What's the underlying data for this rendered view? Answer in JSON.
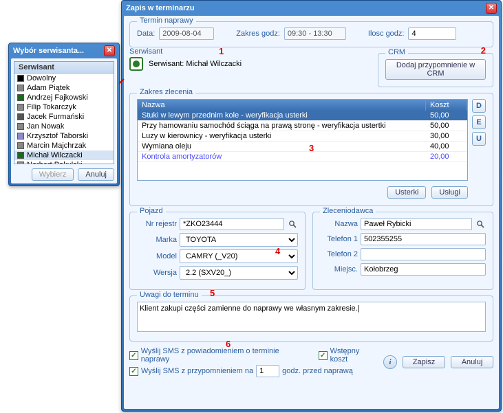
{
  "popup": {
    "title": "Wybór serwisanta...",
    "header": "Serwisant",
    "items": [
      {
        "name": "Dowolny",
        "color": "#000"
      },
      {
        "name": "Adam Piątek",
        "color": "#888"
      },
      {
        "name": "Andrzej Fajkowski",
        "color": "#1a6a1a"
      },
      {
        "name": "Filip Tokarczyk",
        "color": "#888"
      },
      {
        "name": "Jacek Furmański",
        "color": "#555"
      },
      {
        "name": "Jan Nowak",
        "color": "#888"
      },
      {
        "name": "Krzysztof Taborski",
        "color": "#8a8ad0"
      },
      {
        "name": "Marcin Majchrzak",
        "color": "#888"
      },
      {
        "name": "Michał Wilczacki",
        "color": "#1a6a1a"
      },
      {
        "name": "Norbert Pakulski",
        "color": "#888"
      }
    ],
    "btn_select": "Wybierz",
    "btn_cancel": "Anuluj"
  },
  "main": {
    "title": "Zapis w terminarzu",
    "termin": {
      "legend": "Termin naprawy",
      "date_label": "Data:",
      "date_value": "2009-08-04",
      "range_label": "Zakres godz:",
      "range_value": "09:30 - 13:30",
      "hours_label": "Ilosc godz:",
      "hours_value": "4"
    },
    "serwisant": {
      "legend": "Serwisant",
      "text": "Serwisant: Michał Wilczacki"
    },
    "crm": {
      "legend": "CRM",
      "btn": "Dodaj przypomnienie w CRM"
    },
    "zakres": {
      "legend": "Zakres zlecenia",
      "col_name": "Nazwa",
      "col_cost": "Koszt",
      "rows": [
        {
          "name": "Stuki w lewym przednim kole - weryfikacja usterki",
          "cost": "50,00"
        },
        {
          "name": "Przy hamowaniu samochód ściąga na prawą stronę - weryfikacja ustertki",
          "cost": "50,00"
        },
        {
          "name": "Luzy w kierownicy - weryfikacja usterki",
          "cost": "30,00"
        },
        {
          "name": "Wymiana oleju",
          "cost": "40,00"
        },
        {
          "name": "Kontrola amortyzatorów",
          "cost": "20,00"
        }
      ],
      "side": {
        "d": "D",
        "e": "E",
        "u": "U"
      },
      "btn_usterki": "Usterki",
      "btn_uslugi": "Usługi"
    },
    "pojazd": {
      "legend": "Pojazd",
      "nr_label": "Nr rejestr",
      "nr_value": "*ZKO23444",
      "marka_label": "Marka",
      "marka_value": "TOYOTA",
      "model_label": "Model",
      "model_value": "CAMRY (_V20)",
      "wersja_label": "Wersja",
      "wersja_value": "2.2  (SXV20_)"
    },
    "zlec": {
      "legend": "Zleceniodawca",
      "nazwa_label": "Nazwa",
      "nazwa_value": "Paweł Rybicki",
      "tel1_label": "Telefon 1",
      "tel1_value": "502355255",
      "tel2_label": "Telefon 2",
      "tel2_value": "",
      "miejsc_label": "Miejsc.",
      "miejsc_value": "Kołobrzeg"
    },
    "uwagi": {
      "legend": "Uwagi do terminu",
      "text": "Klient zakupi części zamienne do naprawy we własnym zakresie."
    },
    "bottom": {
      "chk1": "Wyślij SMS z powiadomieniem o terminie naprawy",
      "chk2": "Wstępny koszt",
      "chk3_pre": "Wyślij SMS z przypomnieniem na",
      "chk3_val": "1",
      "chk3_post": "godz. przed naprawą",
      "btn_save": "Zapisz",
      "btn_cancel": "Anuluj"
    }
  },
  "annotations": {
    "n1": "1",
    "n2": "2",
    "n3": "3",
    "n4": "4",
    "n5": "5",
    "n6": "6"
  }
}
